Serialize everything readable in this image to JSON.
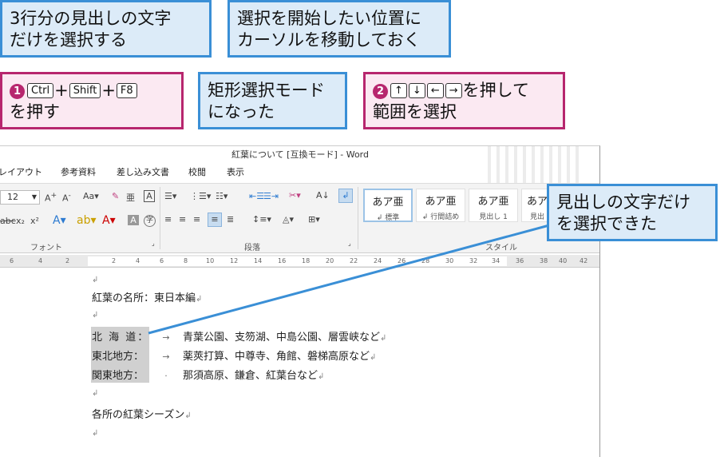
{
  "callouts": {
    "c1": "3行分の見出しの文字だけを選択する",
    "c1_line1": "3行分の見出しの文字",
    "c1_line2": "だけを選択する",
    "c2_line1": "選択を開始したい位置に",
    "c2_line2": "カーソルを移動しておく",
    "c3_num": "1",
    "c3_key1": "Ctrl",
    "c3_key2": "Shift",
    "c3_key3": "F8",
    "c3_plus": "+",
    "c3_line2": "を押す",
    "c4_line1": "矩形選択モード",
    "c4_line2": "になった",
    "c5_num": "2",
    "c5_k1": "↑",
    "c5_k2": "↓",
    "c5_k3": "←",
    "c5_k4": "→",
    "c5_after": "を押して",
    "c5_line2": "範囲を選択",
    "c6_line1": "見出しの文字だけ",
    "c6_line2": "を選択できた"
  },
  "word": {
    "title": "紅葉について [互換モード] - Word",
    "tabs": [
      "レイアウト",
      "参考資料",
      "差し込み文書",
      "校閲",
      "表示"
    ],
    "font_size": "12",
    "group_font": "フォント",
    "group_paragraph": "段落",
    "group_style": "スタイル",
    "styles": [
      {
        "sample": "あア亜",
        "name": "↲ 標準"
      },
      {
        "sample": "あア亜",
        "name": "↲ 行間詰め"
      },
      {
        "sample": "あア亜",
        "name": "見出し 1"
      },
      {
        "sample": "あア",
        "name": "見出"
      }
    ],
    "ruler_ticks": [
      "6",
      "4",
      "2",
      "2",
      "4",
      "6",
      "8",
      "10",
      "12",
      "14",
      "16",
      "18",
      "20",
      "22",
      "24",
      "26",
      "28",
      "30",
      "32",
      "34",
      "36",
      "38",
      "40",
      "42"
    ],
    "doc": {
      "para_mark": "↲",
      "heading": "紅葉の名所：東日本編",
      "rows": [
        {
          "label": "北 海 道：",
          "content": "青葉公園、支笏湖、中島公園、層雲峡など"
        },
        {
          "label": "東北地方：",
          "content": "薬莢打算、中尊寺、角館、磐梯高原など"
        },
        {
          "label": "関東地方：",
          "content": "那須高原、鎌倉、紅葉台など"
        }
      ],
      "footer": "各所の紅葉シーズン"
    }
  },
  "colors": {
    "blue_border": "#3a8fd6",
    "pink_border": "#b7266e",
    "selection": "#d0d0d0"
  }
}
